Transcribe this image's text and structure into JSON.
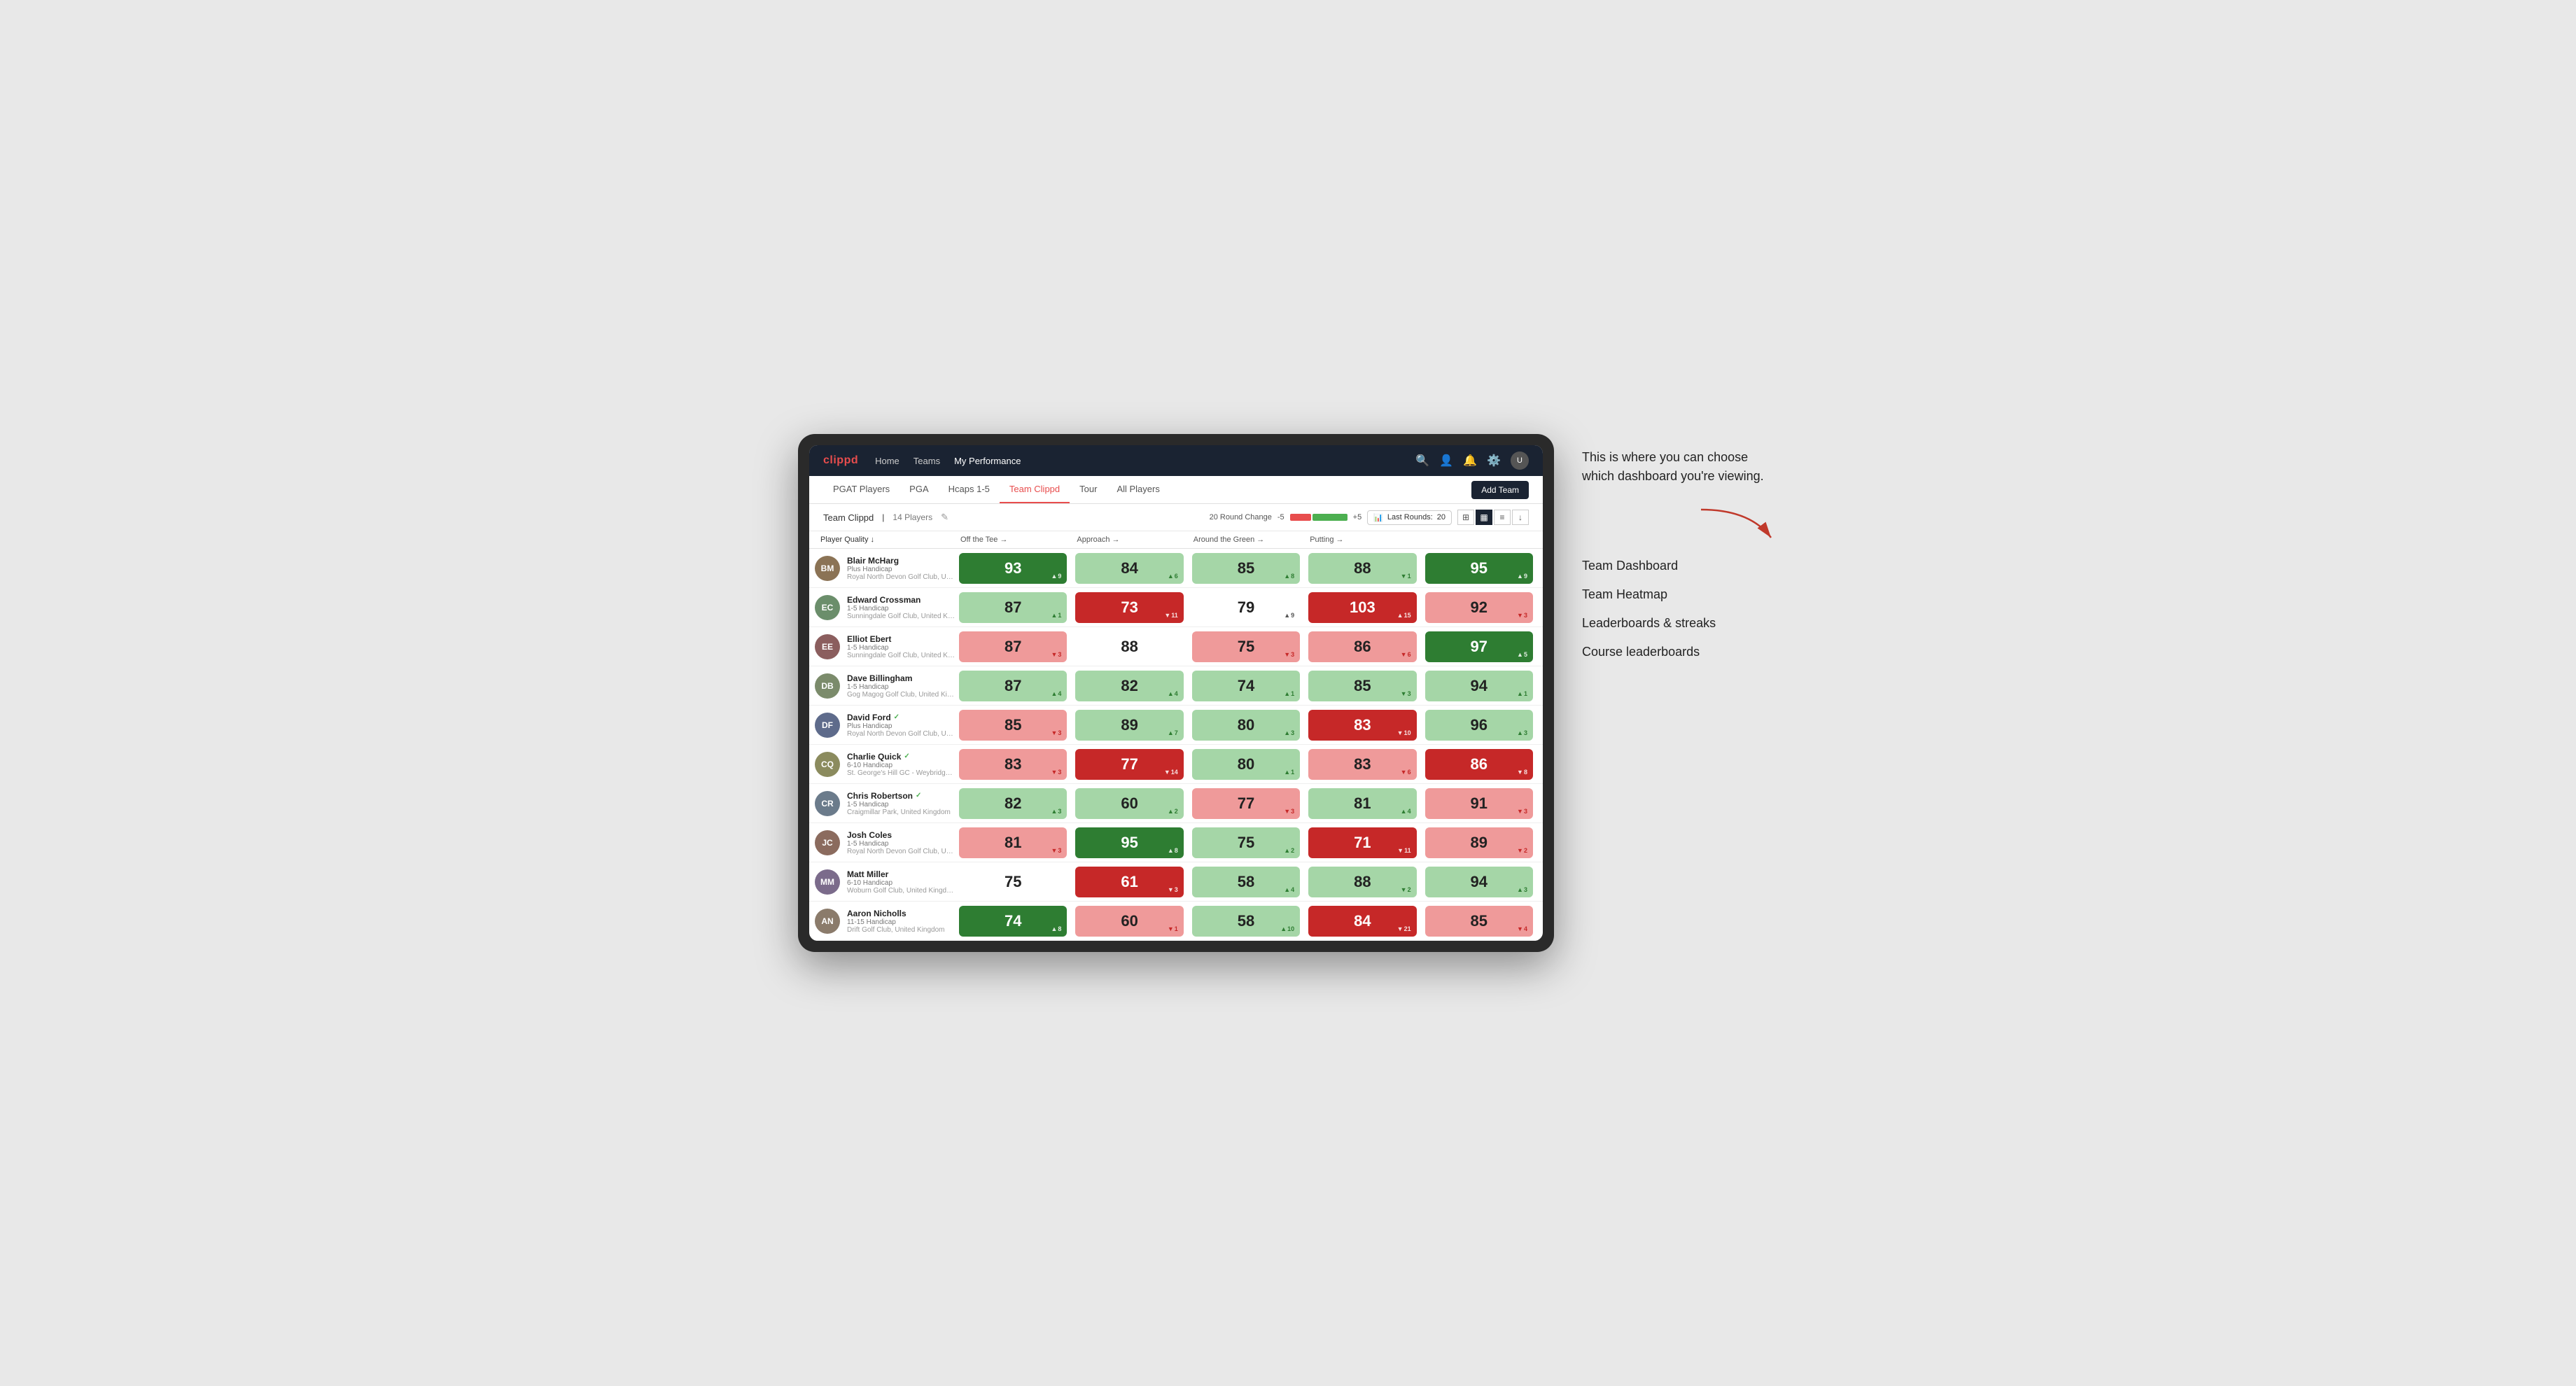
{
  "annotation": {
    "callout": "This is where you can choose which dashboard you're viewing.",
    "items": [
      "Team Dashboard",
      "Team Heatmap",
      "Leaderboards & streaks",
      "Course leaderboards"
    ]
  },
  "nav": {
    "logo": "clippd",
    "links": [
      "Home",
      "Teams",
      "My Performance"
    ],
    "active_link": "My Performance"
  },
  "sub_nav": {
    "links": [
      "PGAT Players",
      "PGA",
      "Hcaps 1-5",
      "Team Clippd",
      "Tour",
      "All Players"
    ],
    "active_link": "Team Clippd",
    "add_team_label": "Add Team"
  },
  "team_header": {
    "name": "Team Clippd",
    "separator": "|",
    "count": "14 Players",
    "round_change_label": "20 Round Change",
    "change_minus": "-5",
    "change_plus": "+5",
    "last_rounds_label": "Last Rounds:",
    "last_rounds_value": "20"
  },
  "columns": {
    "player": "Player Quality ↓",
    "off_tee": "Off the Tee →",
    "approach": "Approach →",
    "around_green": "Around the Green →",
    "putting": "Putting →"
  },
  "players": [
    {
      "name": "Blair McHarg",
      "handicap": "Plus Handicap",
      "club": "Royal North Devon Golf Club, United Kingdom",
      "verified": false,
      "avatar_initials": "BM",
      "avatar_color": "#8B7355",
      "scores": {
        "quality": {
          "value": 93,
          "change": "+9",
          "direction": "up",
          "color": "dark-green"
        },
        "off_tee": {
          "value": 84,
          "change": "+6",
          "direction": "up",
          "color": "light-green"
        },
        "approach": {
          "value": 85,
          "change": "+8",
          "direction": "up",
          "color": "light-green"
        },
        "around_green": {
          "value": 88,
          "change": "-1",
          "direction": "down",
          "color": "light-green"
        },
        "putting": {
          "value": 95,
          "change": "+9",
          "direction": "up",
          "color": "dark-green"
        }
      }
    },
    {
      "name": "Edward Crossman",
      "handicap": "1-5 Handicap",
      "club": "Sunningdale Golf Club, United Kingdom",
      "verified": false,
      "avatar_initials": "EC",
      "avatar_color": "#6B8E6B",
      "scores": {
        "quality": {
          "value": 87,
          "change": "+1",
          "direction": "up",
          "color": "light-green"
        },
        "off_tee": {
          "value": 73,
          "change": "-11",
          "direction": "down",
          "color": "dark-red"
        },
        "approach": {
          "value": 79,
          "change": "+9",
          "direction": "up",
          "color": "neutral"
        },
        "around_green": {
          "value": 103,
          "change": "+15",
          "direction": "up",
          "color": "dark-red"
        },
        "putting": {
          "value": 92,
          "change": "-3",
          "direction": "down",
          "color": "light-red"
        }
      }
    },
    {
      "name": "Elliot Ebert",
      "handicap": "1-5 Handicap",
      "club": "Sunningdale Golf Club, United Kingdom",
      "verified": false,
      "avatar_initials": "EE",
      "avatar_color": "#8B5E5E",
      "scores": {
        "quality": {
          "value": 87,
          "change": "-3",
          "direction": "down",
          "color": "light-red"
        },
        "off_tee": {
          "value": 88,
          "change": "",
          "direction": "none",
          "color": "neutral"
        },
        "approach": {
          "value": 75,
          "change": "-3",
          "direction": "down",
          "color": "light-red"
        },
        "around_green": {
          "value": 86,
          "change": "-6",
          "direction": "down",
          "color": "light-red"
        },
        "putting": {
          "value": 97,
          "change": "+5",
          "direction": "up",
          "color": "dark-green"
        }
      }
    },
    {
      "name": "Dave Billingham",
      "handicap": "1-5 Handicap",
      "club": "Gog Magog Golf Club, United Kingdom",
      "verified": false,
      "avatar_initials": "DB",
      "avatar_color": "#7B8B6B",
      "scores": {
        "quality": {
          "value": 87,
          "change": "+4",
          "direction": "up",
          "color": "light-green"
        },
        "off_tee": {
          "value": 82,
          "change": "+4",
          "direction": "up",
          "color": "light-green"
        },
        "approach": {
          "value": 74,
          "change": "+1",
          "direction": "up",
          "color": "light-green"
        },
        "around_green": {
          "value": 85,
          "change": "-3",
          "direction": "down",
          "color": "light-green"
        },
        "putting": {
          "value": 94,
          "change": "+1",
          "direction": "up",
          "color": "light-green"
        }
      }
    },
    {
      "name": "David Ford",
      "handicap": "Plus Handicap",
      "club": "Royal North Devon Golf Club, United Kingdom",
      "verified": true,
      "avatar_initials": "DF",
      "avatar_color": "#5E6B8B",
      "scores": {
        "quality": {
          "value": 85,
          "change": "-3",
          "direction": "down",
          "color": "light-red"
        },
        "off_tee": {
          "value": 89,
          "change": "+7",
          "direction": "up",
          "color": "light-green"
        },
        "approach": {
          "value": 80,
          "change": "+3",
          "direction": "up",
          "color": "light-green"
        },
        "around_green": {
          "value": 83,
          "change": "-10",
          "direction": "down",
          "color": "dark-red"
        },
        "putting": {
          "value": 96,
          "change": "+3",
          "direction": "up",
          "color": "light-green"
        }
      }
    },
    {
      "name": "Charlie Quick",
      "handicap": "6-10 Handicap",
      "club": "St. George's Hill GC - Weybridge - Surrey, Uni...",
      "verified": true,
      "avatar_initials": "CQ",
      "avatar_color": "#8B8B5E",
      "scores": {
        "quality": {
          "value": 83,
          "change": "-3",
          "direction": "down",
          "color": "light-red"
        },
        "off_tee": {
          "value": 77,
          "change": "-14",
          "direction": "down",
          "color": "dark-red"
        },
        "approach": {
          "value": 80,
          "change": "+1",
          "direction": "up",
          "color": "light-green"
        },
        "around_green": {
          "value": 83,
          "change": "-6",
          "direction": "down",
          "color": "light-red"
        },
        "putting": {
          "value": 86,
          "change": "-8",
          "direction": "down",
          "color": "dark-red"
        }
      }
    },
    {
      "name": "Chris Robertson",
      "handicap": "1-5 Handicap",
      "club": "Craigmillar Park, United Kingdom",
      "verified": true,
      "avatar_initials": "CR",
      "avatar_color": "#6B7B8B",
      "scores": {
        "quality": {
          "value": 82,
          "change": "+3",
          "direction": "up",
          "color": "light-green"
        },
        "off_tee": {
          "value": 60,
          "change": "+2",
          "direction": "up",
          "color": "light-green"
        },
        "approach": {
          "value": 77,
          "change": "-3",
          "direction": "down",
          "color": "light-red"
        },
        "around_green": {
          "value": 81,
          "change": "+4",
          "direction": "up",
          "color": "light-green"
        },
        "putting": {
          "value": 91,
          "change": "-3",
          "direction": "down",
          "color": "light-red"
        }
      }
    },
    {
      "name": "Josh Coles",
      "handicap": "1-5 Handicap",
      "club": "Royal North Devon Golf Club, United Kingdom",
      "verified": false,
      "avatar_initials": "JC",
      "avatar_color": "#8B6B5E",
      "scores": {
        "quality": {
          "value": 81,
          "change": "-3",
          "direction": "down",
          "color": "light-red"
        },
        "off_tee": {
          "value": 95,
          "change": "+8",
          "direction": "up",
          "color": "dark-green"
        },
        "approach": {
          "value": 75,
          "change": "+2",
          "direction": "up",
          "color": "light-green"
        },
        "around_green": {
          "value": 71,
          "change": "-11",
          "direction": "down",
          "color": "dark-red"
        },
        "putting": {
          "value": 89,
          "change": "-2",
          "direction": "down",
          "color": "light-red"
        }
      }
    },
    {
      "name": "Matt Miller",
      "handicap": "6-10 Handicap",
      "club": "Woburn Golf Club, United Kingdom",
      "verified": false,
      "avatar_initials": "MM",
      "avatar_color": "#7B6B8B",
      "scores": {
        "quality": {
          "value": 75,
          "change": "",
          "direction": "none",
          "color": "neutral"
        },
        "off_tee": {
          "value": 61,
          "change": "-3",
          "direction": "down",
          "color": "dark-red"
        },
        "approach": {
          "value": 58,
          "change": "+4",
          "direction": "up",
          "color": "light-green"
        },
        "around_green": {
          "value": 88,
          "change": "-2",
          "direction": "down",
          "color": "light-green"
        },
        "putting": {
          "value": 94,
          "change": "+3",
          "direction": "up",
          "color": "light-green"
        }
      }
    },
    {
      "name": "Aaron Nicholls",
      "handicap": "11-15 Handicap",
      "club": "Drift Golf Club, United Kingdom",
      "verified": false,
      "avatar_initials": "AN",
      "avatar_color": "#8B7B6B",
      "scores": {
        "quality": {
          "value": 74,
          "change": "+8",
          "direction": "up",
          "color": "dark-green"
        },
        "off_tee": {
          "value": 60,
          "change": "-1",
          "direction": "down",
          "color": "light-red"
        },
        "approach": {
          "value": 58,
          "change": "+10",
          "direction": "up",
          "color": "light-green"
        },
        "around_green": {
          "value": 84,
          "change": "-21",
          "direction": "down",
          "color": "dark-red"
        },
        "putting": {
          "value": 85,
          "change": "-4",
          "direction": "down",
          "color": "light-red"
        }
      }
    }
  ]
}
